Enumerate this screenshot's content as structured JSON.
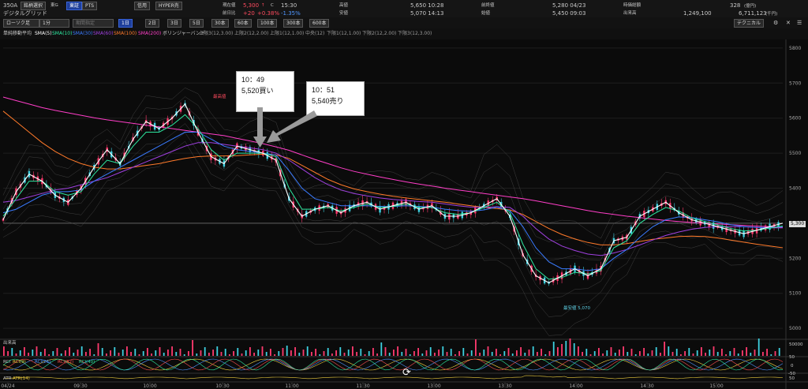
{
  "header": {
    "code": "350A",
    "tabs": [
      "銘柄選択",
      "東G",
      "東証",
      "PTS"
    ],
    "name": "デジタルグリッド",
    "modes": [
      "信用",
      "HYPER売"
    ],
    "current_label": "現在値",
    "current_value": "5,300",
    "current_mark": "↑",
    "current_c": "C",
    "current_time": "15:30",
    "change_label": "前日比",
    "change_value": "+20",
    "change_pct": "+0.38%",
    "change_pct2": "-1.35%",
    "high_label": "高値",
    "high_value": "5,650 10:28",
    "low_label": "安値",
    "low_value": "5,070 14:13",
    "prev_label": "前終値",
    "prev_value": "5,280 04/23",
    "open_label": "始値",
    "open_value": "5,450 09:03",
    "mcap_label": "時価総額",
    "mcap_value": "328",
    "mcap_unit": "(億円)",
    "volume_label": "出来高",
    "volume_value": "1,249,100",
    "turnover_value": "6,711,123",
    "turnover_unit": "(千円)"
  },
  "toolbar": {
    "chart_type": "ローソク足",
    "interval": "1分",
    "period_placeholder": "期間指定",
    "periods": [
      "1日",
      "2日",
      "3日",
      "5日",
      "30本",
      "60本",
      "100本",
      "300本",
      "600本"
    ],
    "technical": "テクニカル"
  },
  "legend": {
    "title": "単純移動平均",
    "items": [
      {
        "label": "SMA(5)",
        "color": "#ffffff"
      },
      {
        "label": "SMA(10)",
        "color": "#2ee8a0"
      },
      {
        "label": "SMA(30)",
        "color": "#3a7bff"
      },
      {
        "label": "SMA(60)",
        "color": "#a040e0"
      },
      {
        "label": "SMA(100)",
        "color": "#ff7a2a"
      },
      {
        "label": "SMA(200)",
        "color": "#ff3ec8"
      }
    ],
    "bb_title": "ボリンジャーバンド",
    "bb_items": [
      "上限3(12,3.00)",
      "上限2(12,2.00)",
      "上限1(12,1.00)",
      "中央(12)",
      "下限1(12,1.00)",
      "下限2(12,2.00)",
      "下限3(12,3.00)"
    ]
  },
  "annotations": {
    "buy": {
      "time": "10：49",
      "text": "5,520買い"
    },
    "sell": {
      "time": "10：51",
      "text": "5,540売り"
    },
    "high_marker": "最高値",
    "low_marker": "最安値 5,070"
  },
  "subpanels": {
    "volume_label": "出来高",
    "volume_scale": "50000",
    "rci_label": "RCI",
    "rci_items": [
      "RCI(9)",
      "RCI(26)",
      "RCI(52)",
      "RCI(40)"
    ],
    "rci_scale": [
      "50",
      "0",
      "-50"
    ],
    "atr_label": "ATR",
    "atr_item": "ATR(14)",
    "atr_scale": "50"
  },
  "chart_data": {
    "type": "line",
    "title": "",
    "xlabel": "",
    "ylabel": "",
    "ylim": [
      4980,
      5820
    ],
    "y_ticks": [
      5800,
      5700,
      5600,
      5500,
      5400,
      5300,
      5200,
      5100,
      5000
    ],
    "last_price_label": "5,300",
    "x_ticks": [
      "04/24",
      "09:30",
      "10:00",
      "10:30",
      "11:00",
      "11:30",
      "13:00",
      "13:30",
      "14:00",
      "14:30",
      "15:00"
    ],
    "x": [
      0,
      5,
      10,
      15,
      20,
      25,
      30,
      35,
      40,
      45,
      50,
      55,
      60,
      65,
      70,
      75,
      80,
      85,
      90,
      95,
      100,
      105,
      110,
      115,
      120,
      125,
      130,
      135,
      140,
      145,
      150,
      155,
      160,
      165,
      170,
      175,
      180,
      185,
      190,
      195,
      200,
      205,
      210,
      215,
      220,
      225,
      230,
      235,
      240,
      245,
      250,
      255,
      260,
      265,
      270,
      275,
      280,
      285,
      290,
      295,
      300
    ],
    "series": [
      {
        "name": "SMA(5)",
        "color": "#ffffff",
        "values": [
          5310,
          5390,
          5440,
          5420,
          5380,
          5360,
          5400,
          5460,
          5510,
          5470,
          5540,
          5590,
          5570,
          5600,
          5640,
          5560,
          5490,
          5470,
          5520,
          5510,
          5500,
          5480,
          5370,
          5320,
          5340,
          5350,
          5330,
          5350,
          5360,
          5340,
          5350,
          5360,
          5340,
          5350,
          5320,
          5320,
          5330,
          5350,
          5370,
          5320,
          5210,
          5150,
          5130,
          5150,
          5170,
          5150,
          5170,
          5250,
          5260,
          5320,
          5340,
          5360,
          5330,
          5310,
          5300,
          5290,
          5280,
          5270,
          5280,
          5290,
          5300
        ]
      },
      {
        "name": "SMA(10)",
        "color": "#2ee8a0",
        "values": [
          5320,
          5370,
          5420,
          5420,
          5390,
          5380,
          5390,
          5440,
          5480,
          5470,
          5520,
          5560,
          5560,
          5580,
          5610,
          5570,
          5510,
          5480,
          5500,
          5500,
          5500,
          5490,
          5400,
          5340,
          5340,
          5345,
          5335,
          5345,
          5355,
          5345,
          5348,
          5355,
          5345,
          5345,
          5330,
          5325,
          5330,
          5345,
          5360,
          5330,
          5240,
          5170,
          5140,
          5145,
          5160,
          5155,
          5165,
          5230,
          5250,
          5300,
          5325,
          5345,
          5335,
          5315,
          5305,
          5295,
          5285,
          5278,
          5280,
          5286,
          5292
        ]
      },
      {
        "name": "SMA(30)",
        "color": "#3a7bff",
        "values": [
          5330,
          5340,
          5360,
          5380,
          5390,
          5390,
          5395,
          5420,
          5440,
          5460,
          5480,
          5500,
          5520,
          5540,
          5560,
          5560,
          5540,
          5520,
          5510,
          5505,
          5500,
          5495,
          5450,
          5400,
          5370,
          5360,
          5350,
          5350,
          5350,
          5348,
          5348,
          5350,
          5348,
          5346,
          5340,
          5336,
          5334,
          5338,
          5346,
          5336,
          5290,
          5230,
          5190,
          5170,
          5170,
          5165,
          5170,
          5200,
          5225,
          5260,
          5290,
          5310,
          5318,
          5316,
          5310,
          5304,
          5296,
          5290,
          5288,
          5288,
          5290
        ]
      },
      {
        "name": "SMA(60)",
        "color": "#a040e0",
        "values": [
          5360,
          5365,
          5375,
          5385,
          5395,
          5400,
          5410,
          5420,
          5430,
          5445,
          5460,
          5475,
          5490,
          5505,
          5520,
          5530,
          5530,
          5525,
          5520,
          5515,
          5510,
          5500,
          5480,
          5455,
          5430,
          5410,
          5395,
          5385,
          5378,
          5372,
          5368,
          5365,
          5362,
          5360,
          5355,
          5350,
          5346,
          5345,
          5347,
          5345,
          5320,
          5285,
          5255,
          5235,
          5222,
          5212,
          5208,
          5215,
          5225,
          5238,
          5252,
          5265,
          5275,
          5283,
          5288,
          5290,
          5290,
          5290,
          5288,
          5287,
          5287
        ]
      },
      {
        "name": "SMA(100)",
        "color": "#ff7a2a",
        "values": [
          5620,
          5590,
          5560,
          5530,
          5505,
          5485,
          5470,
          5460,
          5455,
          5455,
          5460,
          5465,
          5470,
          5478,
          5485,
          5490,
          5492,
          5492,
          5493,
          5495,
          5497,
          5495,
          5485,
          5465,
          5445,
          5425,
          5410,
          5398,
          5390,
          5383,
          5377,
          5372,
          5368,
          5364,
          5360,
          5355,
          5350,
          5345,
          5342,
          5338,
          5325,
          5305,
          5285,
          5268,
          5255,
          5245,
          5238,
          5238,
          5242,
          5248,
          5254,
          5258,
          5262,
          5263,
          5262,
          5258,
          5252,
          5246,
          5240,
          5235,
          5230
        ]
      },
      {
        "name": "SMA(200)",
        "color": "#ff3ec8",
        "values": [
          5660,
          5650,
          5640,
          5630,
          5622,
          5615,
          5608,
          5601,
          5595,
          5590,
          5585,
          5580,
          5575,
          5570,
          5565,
          5560,
          5555,
          5550,
          5542,
          5535,
          5527,
          5518,
          5508,
          5495,
          5482,
          5470,
          5458,
          5448,
          5440,
          5432,
          5425,
          5418,
          5412,
          5406,
          5400,
          5395,
          5390,
          5385,
          5380,
          5375,
          5370,
          5364,
          5357,
          5350,
          5343,
          5336,
          5330,
          5325,
          5320,
          5316,
          5312,
          5308,
          5305,
          5302,
          5300,
          5298,
          5296,
          5294,
          5292,
          5290,
          5288
        ]
      }
    ]
  }
}
